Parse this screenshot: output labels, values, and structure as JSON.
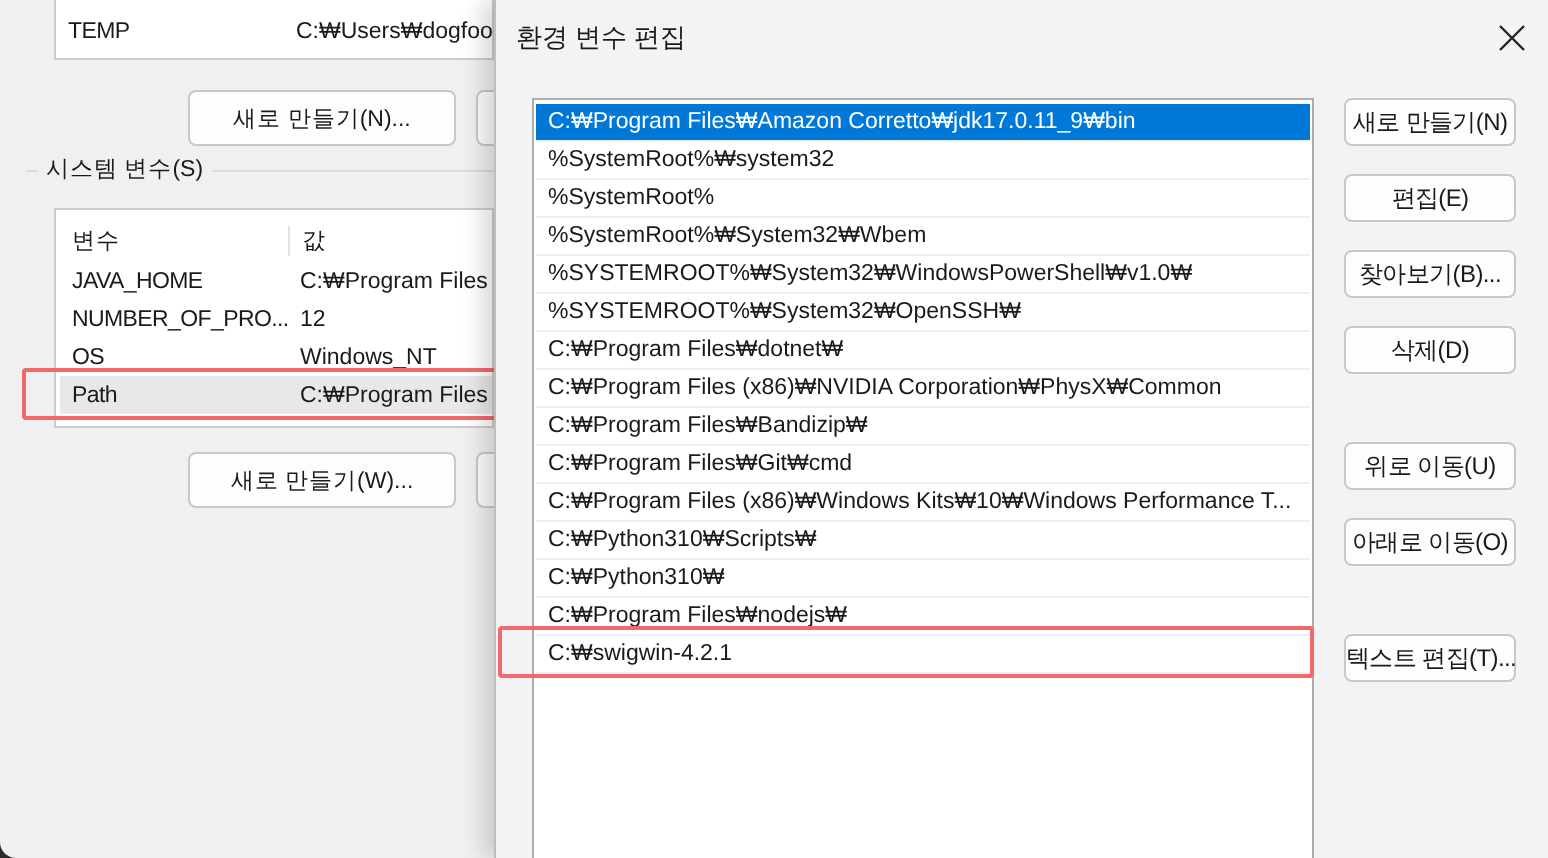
{
  "background_window": {
    "user_variables": {
      "rows": [
        {
          "name": "TEMP",
          "value": "C:₩Users₩dogfoo"
        }
      ],
      "buttons": [
        "새로 만들기(N)..."
      ]
    },
    "system_variables": {
      "title": "시스템 변수(S)",
      "columns": [
        "변수",
        "값"
      ],
      "rows": [
        {
          "name": "JAVA_HOME",
          "value": "C:₩Program Files",
          "selected": false,
          "highlighted": false
        },
        {
          "name": "NUMBER_OF_PRO...",
          "value": "12",
          "selected": false,
          "highlighted": false
        },
        {
          "name": "OS",
          "value": "Windows_NT",
          "selected": false,
          "highlighted": false
        },
        {
          "name": "Path",
          "value": "C:₩Program Files",
          "selected": true,
          "highlighted": true
        }
      ],
      "buttons": [
        "새로 만들기(W)..."
      ]
    }
  },
  "dialog": {
    "title": "환경 변수 편집",
    "paths": [
      {
        "text": "C:₩Program Files₩Amazon Corretto₩jdk17.0.11_9₩bin",
        "selected": true,
        "highlighted": false
      },
      {
        "text": "%SystemRoot%₩system32",
        "selected": false,
        "highlighted": false
      },
      {
        "text": "%SystemRoot%",
        "selected": false,
        "highlighted": false
      },
      {
        "text": "%SystemRoot%₩System32₩Wbem",
        "selected": false,
        "highlighted": false
      },
      {
        "text": "%SYSTEMROOT%₩System32₩WindowsPowerShell₩v1.0₩",
        "selected": false,
        "highlighted": false
      },
      {
        "text": "%SYSTEMROOT%₩System32₩OpenSSH₩",
        "selected": false,
        "highlighted": false
      },
      {
        "text": "C:₩Program Files₩dotnet₩",
        "selected": false,
        "highlighted": false
      },
      {
        "text": "C:₩Program Files (x86)₩NVIDIA Corporation₩PhysX₩Common",
        "selected": false,
        "highlighted": false
      },
      {
        "text": "C:₩Program Files₩Bandizip₩",
        "selected": false,
        "highlighted": false
      },
      {
        "text": "C:₩Program Files₩Git₩cmd",
        "selected": false,
        "highlighted": false
      },
      {
        "text": "C:₩Program Files (x86)₩Windows Kits₩10₩Windows Performance T...",
        "selected": false,
        "highlighted": false
      },
      {
        "text": "C:₩Python310₩Scripts₩",
        "selected": false,
        "highlighted": false
      },
      {
        "text": "C:₩Python310₩",
        "selected": false,
        "highlighted": false
      },
      {
        "text": "C:₩Program Files₩nodejs₩",
        "selected": false,
        "highlighted": false
      },
      {
        "text": "C:₩swigwin-4.2.1",
        "selected": false,
        "highlighted": true
      }
    ],
    "button_groups": [
      [
        "새로 만들기(N)",
        "편집(E)",
        "찾아보기(B)...",
        "삭제(D)"
      ],
      [
        "위로 이동(U)",
        "아래로 이동(O)"
      ],
      [
        "텍스트 편집(T)..."
      ]
    ]
  }
}
